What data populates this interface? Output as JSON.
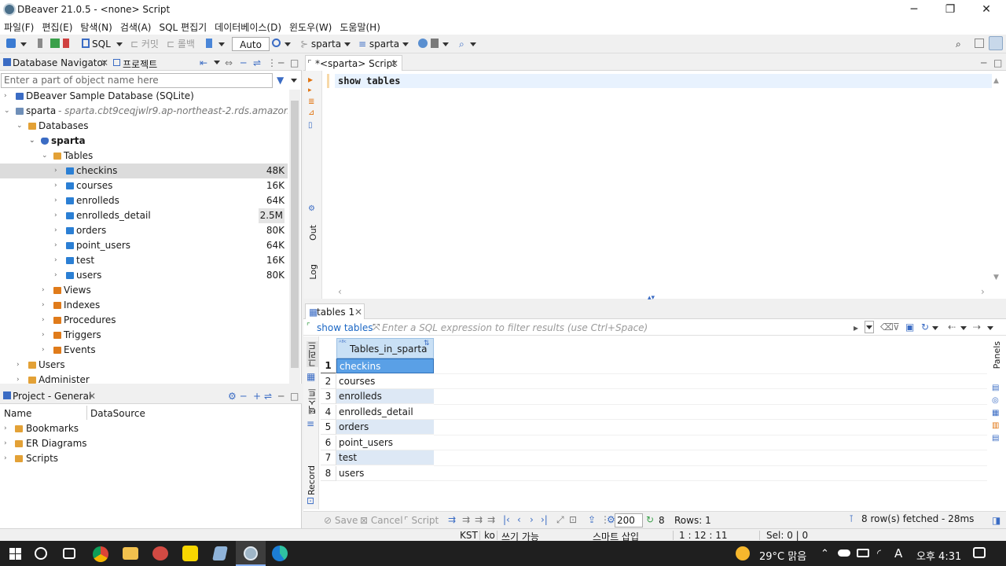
{
  "window": {
    "title": "DBeaver 21.0.5 - <none> Script",
    "minimize": "─",
    "restore": "❐",
    "close": "✕"
  },
  "menu": [
    "파일(F)",
    "편집(E)",
    "탐색(N)",
    "검색(A)",
    "SQL 편집기",
    "데이터베이스(D)",
    "윈도우(W)",
    "도움말(H)"
  ],
  "toolbar": {
    "sql_label": "SQL",
    "commit_label": "커밋",
    "rollback_label": "롤백",
    "auto_label": "Auto",
    "datasource_label": "sparta",
    "schema_label": "sparta"
  },
  "navigator": {
    "tab_label": "Database Navigator",
    "project_tab_label": "프로젝트",
    "filter_placeholder": "Enter a part of object name here",
    "tree": [
      {
        "label": "DBeaver Sample Database (SQLite)"
      },
      {
        "label": "sparta",
        "detail": "- sparta.cbt9ceqjwlr9.ap-northeast-2.rds.amazonaws.co"
      },
      {
        "label": "Databases"
      },
      {
        "label": "sparta"
      },
      {
        "label": "Tables"
      },
      {
        "label": "checkins",
        "size": "48K"
      },
      {
        "label": "courses",
        "size": "16K"
      },
      {
        "label": "enrolleds",
        "size": "64K"
      },
      {
        "label": "enrolleds_detail",
        "size": "2.5M"
      },
      {
        "label": "orders",
        "size": "80K"
      },
      {
        "label": "point_users",
        "size": "64K"
      },
      {
        "label": "test",
        "size": "16K"
      },
      {
        "label": "users",
        "size": "80K"
      },
      {
        "label": "Views"
      },
      {
        "label": "Indexes"
      },
      {
        "label": "Procedures"
      },
      {
        "label": "Triggers"
      },
      {
        "label": "Events"
      },
      {
        "label": "Users"
      },
      {
        "label": "Administer"
      }
    ]
  },
  "project": {
    "tab_label": "Project - General",
    "col_name": "Name",
    "col_datasource": "DataSource",
    "items": [
      "Bookmarks",
      "ER Diagrams",
      "Scripts"
    ]
  },
  "editor": {
    "tab_label": "*<sparta> Script",
    "code": "show tables",
    "side_out": "Out",
    "side_log": "Log"
  },
  "results": {
    "tab_label": "tables 1",
    "query_label": "show tables",
    "filter_placeholder": "Enter a SQL expression to filter results (use Ctrl+Space)",
    "column_header": "Tables_in_sparta",
    "rows": [
      "checkins",
      "courses",
      "enrolleds",
      "enrolleds_detail",
      "orders",
      "point_users",
      "test",
      "users"
    ],
    "row_numbers": [
      "1",
      "2",
      "3",
      "4",
      "5",
      "6",
      "7",
      "8"
    ],
    "side_grid": "그리드",
    "side_text": "텍스트",
    "side_record": "Record",
    "side_panels": "Panels",
    "save_label": "Save",
    "cancel_label": "Cancel",
    "script_label": "Script",
    "fetch_size": "200",
    "fetched_count": "8",
    "rows_label": "Rows: 1",
    "fetched_status": "8 row(s) fetched - 28ms"
  },
  "statusbar": {
    "timezone": "KST",
    "locale": "ko",
    "write_mode": "쓰기 가능",
    "insert_mode": "스마트 삽입",
    "position": "1 : 12 : 11",
    "selection": "Sel: 0 | 0"
  },
  "taskbar": {
    "weather": "29°C  맑음",
    "ime": "A",
    "time": "오후 4:31"
  }
}
